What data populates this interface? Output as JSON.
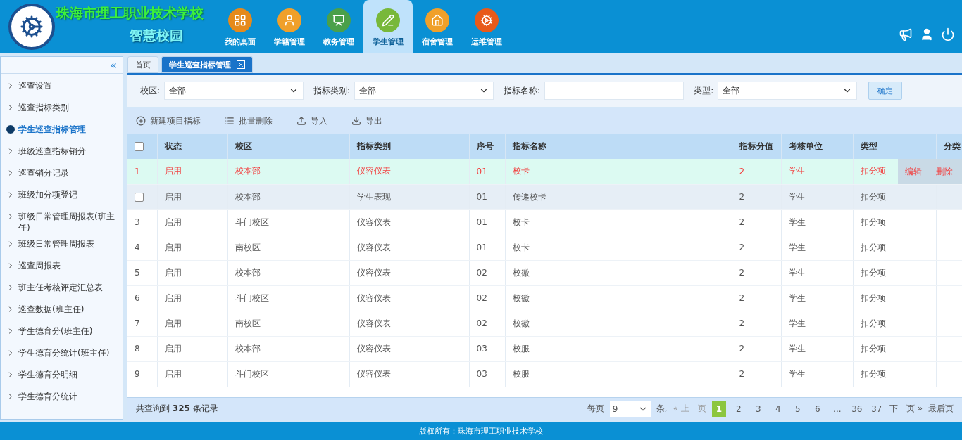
{
  "header": {
    "school_name": "珠海市理工职业技术学校",
    "subtitle": "智慧校园",
    "nav": [
      {
        "label": "我的桌面",
        "selected": false
      },
      {
        "label": "学籍管理",
        "selected": false
      },
      {
        "label": "教务管理",
        "selected": false
      },
      {
        "label": "学生管理",
        "selected": true
      },
      {
        "label": "宿舍管理",
        "selected": false
      },
      {
        "label": "运维管理",
        "selected": false
      }
    ]
  },
  "sidebar": {
    "collapse": "«",
    "items": [
      {
        "label": "巡查设置",
        "selected": false
      },
      {
        "label": "巡查指标类别",
        "selected": false
      },
      {
        "label": "学生巡查指标管理",
        "selected": true
      },
      {
        "label": "班级巡查指标销分",
        "selected": false
      },
      {
        "label": "巡查销分记录",
        "selected": false
      },
      {
        "label": "班级加分项登记",
        "selected": false
      },
      {
        "label": "班级日常管理周报表(班主任)",
        "selected": false
      },
      {
        "label": "班级日常管理周报表",
        "selected": false
      },
      {
        "label": "巡查周报表",
        "selected": false
      },
      {
        "label": "班主任考核评定汇总表",
        "selected": false
      },
      {
        "label": "巡查数据(班主任)",
        "selected": false
      },
      {
        "label": "学生德育分(班主任)",
        "selected": false
      },
      {
        "label": "学生德育分统计(班主任)",
        "selected": false
      },
      {
        "label": "学生德育分明细",
        "selected": false
      },
      {
        "label": "学生德育分统计",
        "selected": false
      }
    ]
  },
  "tabs": [
    {
      "label": "首页",
      "selected": false,
      "closable": false
    },
    {
      "label": "学生巡查指标管理",
      "selected": true,
      "closable": true
    }
  ],
  "filters": [
    {
      "kind": "select",
      "label": "校区:",
      "value": "全部"
    },
    {
      "kind": "select",
      "label": "指标类别:",
      "value": "全部"
    },
    {
      "kind": "input",
      "label": "指标名称:"
    },
    {
      "kind": "select",
      "label": "类型:",
      "value": "全部"
    }
  ],
  "confirm_button": "确定",
  "toolbar": [
    {
      "kind": "add",
      "label": "新建项目指标"
    },
    {
      "kind": "batch",
      "label": "批量删除"
    },
    {
      "kind": "import",
      "label": "导入"
    },
    {
      "kind": "export",
      "label": "导出"
    }
  ],
  "table": {
    "header_checkbox": {
      "checked": false
    },
    "columns": [
      "状态",
      "校区",
      "指标类别",
      "序号",
      "指标名称",
      "指标分值",
      "考核单位",
      "类型",
      "分类"
    ],
    "rows": [
      {
        "index": "1",
        "selected": true,
        "hovered": false,
        "cells": [
          "启用",
          "校本部",
          "仪容仪表",
          "01",
          "校卡",
          "2",
          "学生",
          "扣分项"
        ],
        "actions": [
          "编辑",
          "删除"
        ]
      },
      {
        "selected": false,
        "hovered": true,
        "checked": false,
        "cells": [
          "启用",
          "校本部",
          "学生表现",
          "01",
          "传递校卡",
          "2",
          "学生",
          "扣分项"
        ]
      },
      {
        "index": "3",
        "selected": false,
        "hovered": false,
        "cells": [
          "启用",
          "斗门校区",
          "仪容仪表",
          "01",
          "校卡",
          "2",
          "学生",
          "扣分项"
        ]
      },
      {
        "index": "4",
        "selected": false,
        "hovered": false,
        "cells": [
          "启用",
          "南校区",
          "仪容仪表",
          "01",
          "校卡",
          "2",
          "学生",
          "扣分项"
        ]
      },
      {
        "index": "5",
        "selected": false,
        "hovered": false,
        "cells": [
          "启用",
          "校本部",
          "仪容仪表",
          "02",
          "校徽",
          "2",
          "学生",
          "扣分项"
        ]
      },
      {
        "index": "6",
        "selected": false,
        "hovered": false,
        "cells": [
          "启用",
          "斗门校区",
          "仪容仪表",
          "02",
          "校徽",
          "2",
          "学生",
          "扣分项"
        ]
      },
      {
        "index": "7",
        "selected": false,
        "hovered": false,
        "cells": [
          "启用",
          "南校区",
          "仪容仪表",
          "02",
          "校徽",
          "2",
          "学生",
          "扣分项"
        ]
      },
      {
        "index": "8",
        "selected": false,
        "hovered": false,
        "cells": [
          "启用",
          "校本部",
          "仪容仪表",
          "03",
          "校服",
          "2",
          "学生",
          "扣分项"
        ]
      },
      {
        "index": "9",
        "selected": false,
        "hovered": false,
        "cells": [
          "启用",
          "斗门校区",
          "仪容仪表",
          "03",
          "校服",
          "2",
          "学生",
          "扣分项"
        ]
      }
    ]
  },
  "pagination": {
    "summary": "共查询到 **325** 条记录",
    "per_page_label": "每页",
    "per_page": "9",
    "unit": "条,",
    "prev": "« 上一页",
    "pages": [
      {
        "label": "1",
        "selected": true
      },
      {
        "label": "2",
        "selected": false
      },
      {
        "label": "3",
        "selected": false
      },
      {
        "label": "4",
        "selected": false
      },
      {
        "label": "5",
        "selected": false
      },
      {
        "label": "6",
        "selected": false
      },
      {
        "label": "...",
        "selected": false
      },
      {
        "label": "36",
        "selected": false
      },
      {
        "label": "37",
        "selected": false
      }
    ],
    "next": "下一页 »",
    "last": "最后页"
  },
  "footer": "版权所有：珠海市理工职业技术学校"
}
